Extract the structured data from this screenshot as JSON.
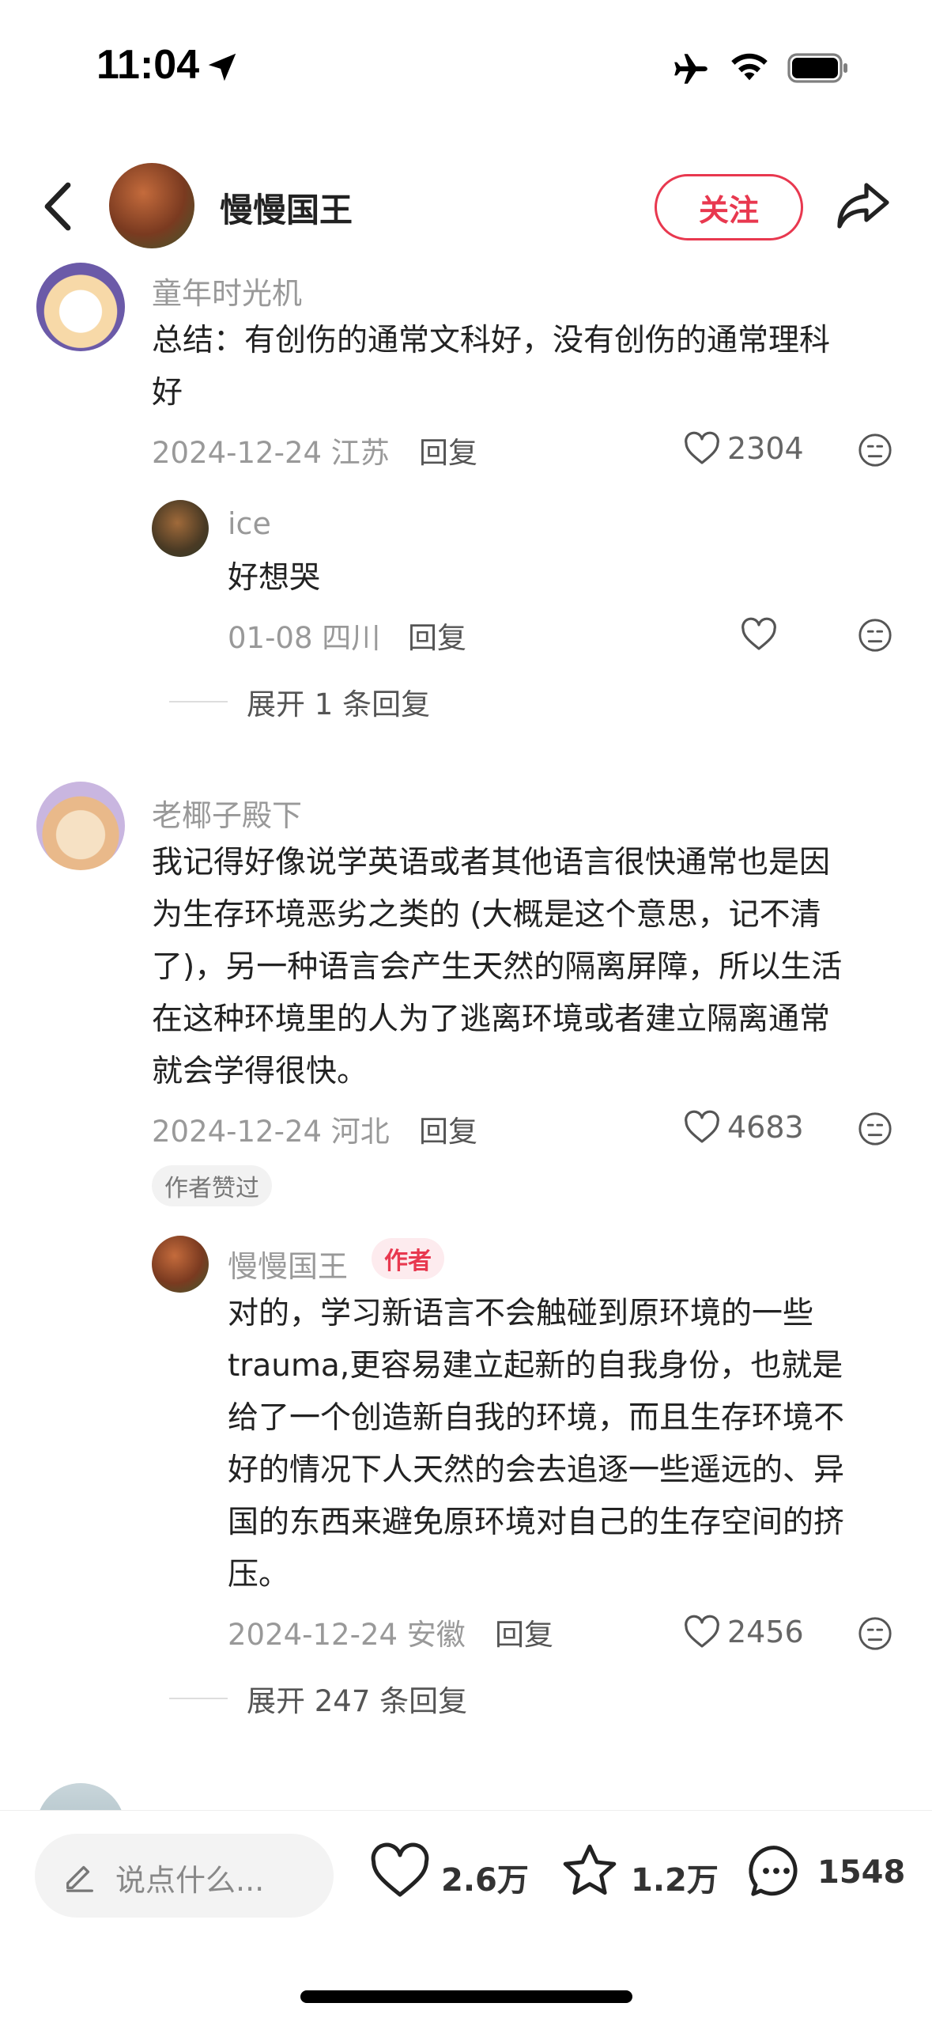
{
  "status_bar": {
    "time": "11:04"
  },
  "header": {
    "title": "慢慢国王",
    "follow_label": "关注"
  },
  "comments": [
    {
      "user": "童年时光机",
      "text_lines": [
        "总结：有创伤的通常文科好，没有创伤的通常理科",
        "好"
      ],
      "date_loc": "2024-12-24 江苏",
      "reply_label": "回复",
      "likes": "2304",
      "replies": [
        {
          "user": "ice",
          "text": "好想哭",
          "date_loc": "01-08 四川",
          "reply_label": "回复",
          "likes": ""
        }
      ],
      "expand_label": "展开 1 条回复"
    },
    {
      "user": "老椰子殿下",
      "text_lines": [
        "我记得好像说学英语或者其他语言很快通常也是因",
        "为生存环境恶劣之类的 (大概是这个意思，记不清",
        "了)，另一种语言会产生天然的隔离屏障，所以生活",
        "在这种环境里的人为了逃离环境或者建立隔离通常",
        "就会学得很快。"
      ],
      "date_loc": "2024-12-24 河北",
      "reply_label": "回复",
      "likes": "4683",
      "badge": "作者赞过",
      "replies": [
        {
          "user": "慢慢国王",
          "author_tag": "作者",
          "text_lines": [
            "对的，学习新语言不会触碰到原环境的一些",
            "trauma,更容易建立起新的自我身份，也就是",
            "给了一个创造新自我的环境，而且生存环境不",
            "好的情况下人天然的会去追逐一些遥远的、异",
            "国的东西来避免原环境对自己的生存空间的挤",
            "压。"
          ],
          "date_loc": "2024-12-24 安徽",
          "reply_label": "回复",
          "likes": "2456"
        }
      ],
      "expand_label": "展开 247 条回复"
    }
  ],
  "bottom_bar": {
    "input_placeholder": "说点什么...",
    "likes": "2.6万",
    "stars": "1.2万",
    "comments": "1548"
  },
  "colors": {
    "accent": "#e8384f",
    "muted": "#999999",
    "text": "#222222"
  }
}
